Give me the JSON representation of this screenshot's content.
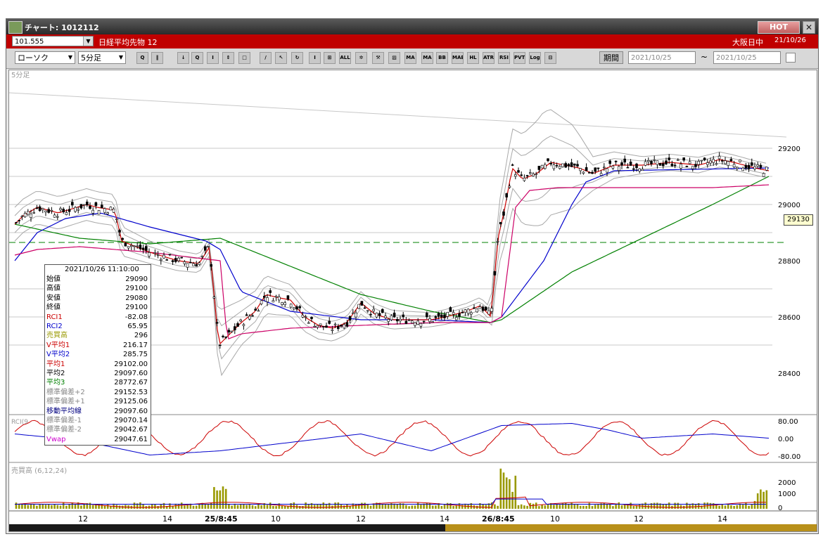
{
  "window": {
    "title": "チャート: 1012112",
    "hot_label": "HOT",
    "close_label": "✕"
  },
  "instrument": {
    "code": "101.555",
    "name": "日経平均先物 12",
    "session": "大阪日中",
    "date": "21/10/26"
  },
  "toolbar": {
    "chart_type": "ローソク",
    "interval": "5分足",
    "buttons": [
      "zoom",
      "bar",
      "down",
      "find",
      "candle",
      "arrow",
      "doc",
      "pen",
      "cursor",
      "spin",
      "bar2",
      "box",
      "all",
      "settings",
      "wrench",
      "color",
      "ma",
      "ma2",
      "bb",
      "mae",
      "hl",
      "atr",
      "rsi",
      "pvt",
      "log",
      "sep"
    ],
    "period_label": "期間",
    "date_from": "2021/10/25",
    "date_to": "2021/10/25",
    "tilde": "~"
  },
  "chart": {
    "interval_label": "5分足",
    "price_ticks": [
      "29200",
      "29000",
      "28800",
      "28600",
      "28400"
    ],
    "current_price": "29130",
    "osc_ticks": [
      "80.00",
      "0.00",
      "-80.00"
    ],
    "vol_ticks": [
      "2000",
      "1000",
      "0"
    ],
    "vol_label": "売買高 (6,12,24)",
    "rci_label": "RCI(9",
    "time_labels": [
      {
        "t": "12",
        "bold": false
      },
      {
        "t": "14",
        "bold": false
      },
      {
        "t": "25/8:45",
        "bold": true
      },
      {
        "t": "10",
        "bold": false
      },
      {
        "t": "12",
        "bold": false
      },
      {
        "t": "14",
        "bold": false
      },
      {
        "t": "26/8:45",
        "bold": true
      },
      {
        "t": "10",
        "bold": false
      },
      {
        "t": "12",
        "bold": false
      },
      {
        "t": "14",
        "bold": false
      }
    ]
  },
  "infobox": {
    "datetime": "2021/10/26  11:10:00",
    "rows": [
      {
        "k": "始値",
        "v": "29090",
        "c": "#000000"
      },
      {
        "k": "高値",
        "v": "29100",
        "c": "#000000"
      },
      {
        "k": "安値",
        "v": "29080",
        "c": "#000000"
      },
      {
        "k": "終値",
        "v": "29100",
        "c": "#000000"
      },
      {
        "k": "RCI1",
        "v": "-82.08",
        "c": "#cc0000"
      },
      {
        "k": "RCI2",
        "v": "65.95",
        "c": "#0000cc"
      },
      {
        "k": "売買高",
        "v": "296",
        "c": "#999900"
      },
      {
        "k": "V平均1",
        "v": "216.17",
        "c": "#cc0000"
      },
      {
        "k": "V平均2",
        "v": "285.75",
        "c": "#0000cc"
      },
      {
        "k": "平均1",
        "v": "29102.00",
        "c": "#cc0000"
      },
      {
        "k": "平均2",
        "v": "29097.60",
        "c": "#000000"
      },
      {
        "k": "平均3",
        "v": "28772.67",
        "c": "#008000"
      },
      {
        "k": "標準偏差+2",
        "v": "29152.53",
        "c": "#888888"
      },
      {
        "k": "標準偏差+1",
        "v": "29125.06",
        "c": "#888888"
      },
      {
        "k": "移動平均線",
        "v": "29097.60",
        "c": "#000080"
      },
      {
        "k": "標準偏差-1",
        "v": "29070.14",
        "c": "#888888"
      },
      {
        "k": "標準偏差-2",
        "v": "29042.67",
        "c": "#888888"
      },
      {
        "k": "Vwap",
        "v": "29047.61",
        "c": "#cc00cc"
      }
    ]
  },
  "colors": {
    "titlebar": "#3a3a3a",
    "redbar": "#c00000",
    "candle_up": "#ffffff",
    "candle_down": "#000000",
    "ma_fast": "#cc0000",
    "ma_mid": "#0000cc",
    "ma_slow": "#008000",
    "vwap": "#cc0066",
    "bollinger": "#999999",
    "volume": "#999900"
  }
}
